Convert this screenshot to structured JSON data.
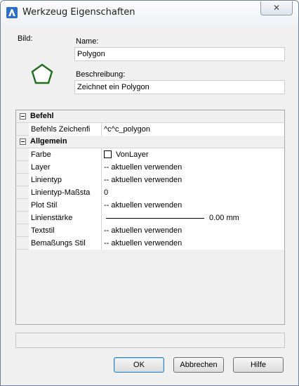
{
  "window": {
    "title": "Werkzeug Eigenschaften",
    "close_label": "✕"
  },
  "form": {
    "bild_label": "Bild:",
    "name_label": "Name:",
    "name_value": "Polygon",
    "beschreibung_label": "Beschreibung:",
    "beschreibung_value": "Zeichnet ein Polygon",
    "icon": "pentagon-icon"
  },
  "grid": {
    "categories": [
      {
        "label": "Befehl",
        "rows": [
          {
            "name": "Befehls Zeichenfi",
            "value": "^c^c_polygon"
          }
        ]
      },
      {
        "label": "Allgemein",
        "rows": [
          {
            "name": "Farbe",
            "value": "VonLayer"
          },
          {
            "name": "Layer",
            "value": "-- aktuellen verwenden"
          },
          {
            "name": "Linientyp",
            "value": "-- aktuellen verwenden"
          },
          {
            "name": "Linientyp-Maßsta",
            "value": "0"
          },
          {
            "name": "Plot Stil",
            "value": "-- aktuellen verwenden"
          },
          {
            "name": "Linienstärke",
            "value": "0.00 mm"
          },
          {
            "name": "Textstil",
            "value": "-- aktuellen verwenden"
          },
          {
            "name": "Bemaßungs Stil",
            "value": "-- aktuellen verwenden"
          }
        ]
      }
    ]
  },
  "buttons": {
    "ok": "OK",
    "cancel": "Abbrechen",
    "help": "Hilfe"
  }
}
